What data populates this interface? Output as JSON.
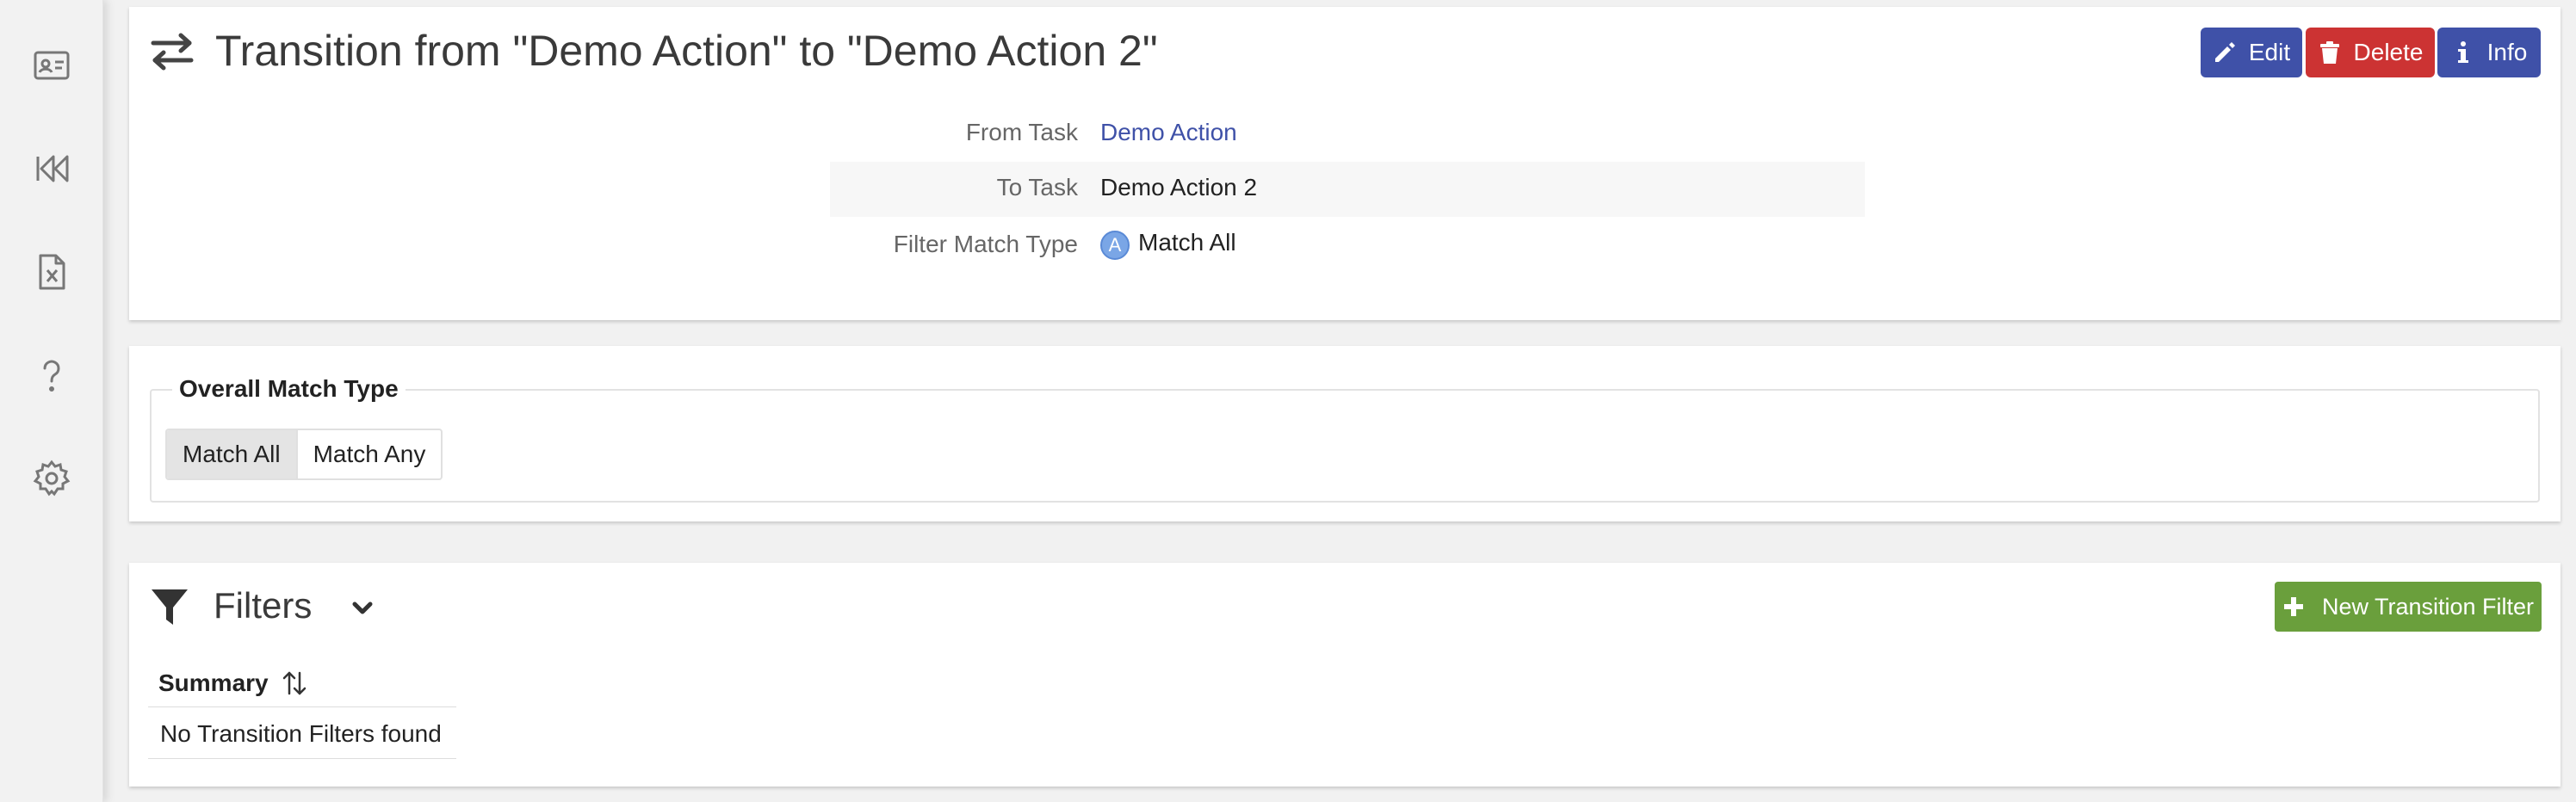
{
  "sidebar": {
    "items": [
      {
        "icon": "contact-card-icon"
      },
      {
        "icon": "rewind-icon"
      },
      {
        "icon": "spreadsheet-file-icon"
      },
      {
        "icon": "help-icon"
      },
      {
        "icon": "gear-icon"
      }
    ]
  },
  "header": {
    "title": "Transition from \"Demo Action\" to \"Demo Action 2\"",
    "icon": "transfer-arrows-icon",
    "buttons": {
      "edit": "Edit",
      "delete": "Delete",
      "info": "Info"
    }
  },
  "details": {
    "from_task_label": "From Task",
    "from_task_value": "Demo Action",
    "to_task_label": "To Task",
    "to_task_value": "Demo Action 2",
    "filter_match_label": "Filter Match Type",
    "filter_match_badge": "A",
    "filter_match_value": "Match All"
  },
  "overall_match": {
    "legend": "Overall Match Type",
    "options": [
      "Match All",
      "Match Any"
    ],
    "selected": "Match All"
  },
  "filters": {
    "title": "Filters",
    "new_button": "New Transition Filter",
    "columns": [
      "Summary"
    ],
    "empty_message": "No Transition Filters found"
  },
  "colors": {
    "primary": "#3f51a8",
    "danger": "#cc3333",
    "success": "#6a9f3c"
  }
}
